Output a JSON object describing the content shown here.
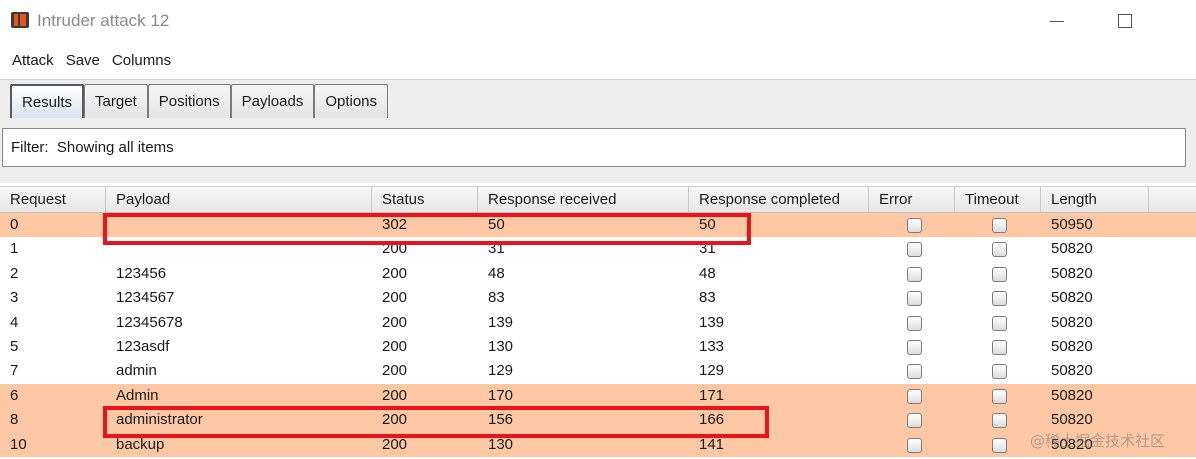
{
  "window": {
    "title": "Intruder attack 12",
    "icon": "burp-intruder-icon"
  },
  "menu": [
    "Attack",
    "Save",
    "Columns"
  ],
  "tabs": [
    "Results",
    "Target",
    "Positions",
    "Payloads",
    "Options"
  ],
  "active_tab": "Results",
  "filter": {
    "label": "Filter:",
    "value": "Showing all items"
  },
  "table": {
    "columns": [
      "Request",
      "Payload",
      "Status",
      "Response received",
      "Response completed",
      "Error",
      "Timeout",
      "Length"
    ],
    "rows": [
      {
        "request": "0",
        "payload": "",
        "status": "302",
        "received": "50",
        "completed": "50",
        "error": false,
        "timeout": false,
        "length": "50950",
        "highlighted": true
      },
      {
        "request": "1",
        "payload": "",
        "status": "200",
        "received": "31",
        "completed": "31",
        "error": false,
        "timeout": false,
        "length": "50820",
        "highlighted": false
      },
      {
        "request": "2",
        "payload": "123456",
        "status": "200",
        "received": "48",
        "completed": "48",
        "error": false,
        "timeout": false,
        "length": "50820",
        "highlighted": false
      },
      {
        "request": "3",
        "payload": "1234567",
        "status": "200",
        "received": "83",
        "completed": "83",
        "error": false,
        "timeout": false,
        "length": "50820",
        "highlighted": false
      },
      {
        "request": "4",
        "payload": "12345678",
        "status": "200",
        "received": "139",
        "completed": "139",
        "error": false,
        "timeout": false,
        "length": "50820",
        "highlighted": false
      },
      {
        "request": "5",
        "payload": "123asdf",
        "status": "200",
        "received": "130",
        "completed": "133",
        "error": false,
        "timeout": false,
        "length": "50820",
        "highlighted": false
      },
      {
        "request": "7",
        "payload": "admin",
        "status": "200",
        "received": "129",
        "completed": "129",
        "error": false,
        "timeout": false,
        "length": "50820",
        "highlighted": false
      },
      {
        "request": "6",
        "payload": "Admin",
        "status": "200",
        "received": "170",
        "completed": "171",
        "error": false,
        "timeout": false,
        "length": "50820",
        "highlighted": true
      },
      {
        "request": "8",
        "payload": "administrator",
        "status": "200",
        "received": "156",
        "completed": "166",
        "error": false,
        "timeout": false,
        "length": "50820",
        "highlighted": true
      },
      {
        "request": "10",
        "payload": "backup",
        "status": "200",
        "received": "130",
        "completed": "141",
        "error": false,
        "timeout": false,
        "length": "50820",
        "highlighted": true
      }
    ]
  },
  "colors": {
    "highlight_row": "#ffc8a4",
    "annotation_box": "#e8141b"
  },
  "watermark": "@稀土掘金技术社区"
}
